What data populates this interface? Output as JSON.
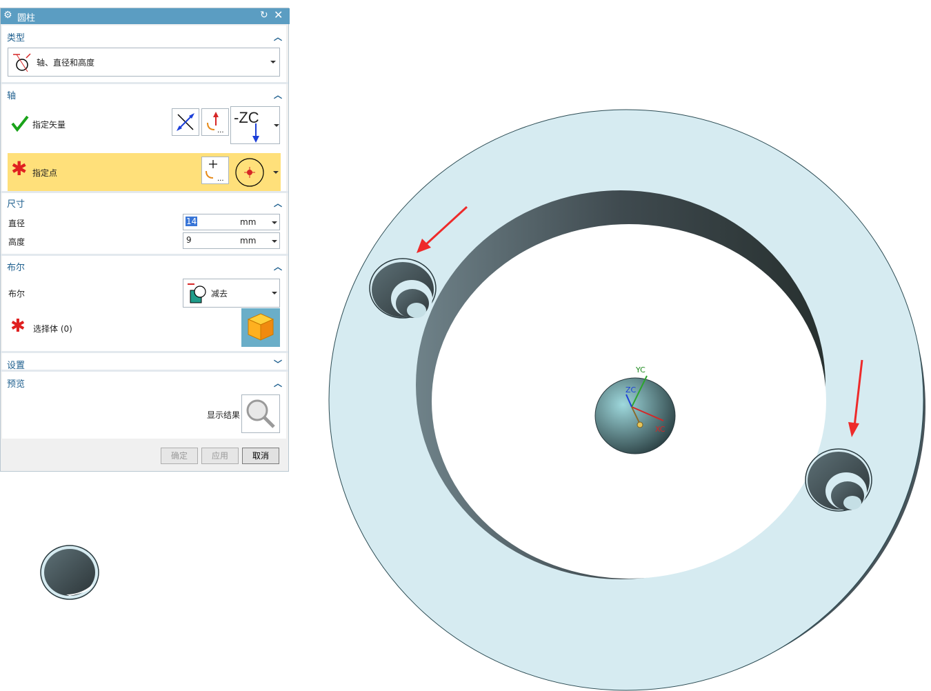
{
  "dialog": {
    "title": "圆柱",
    "sections": {
      "type": {
        "title": "类型",
        "selected": "轴、直径和高度"
      },
      "axis": {
        "title": "轴",
        "vector_label": "指定矢量",
        "point_label": "指定点",
        "vector_value": "-ZC"
      },
      "dimension": {
        "title": "尺寸",
        "diameter_label": "直径",
        "diameter_value": "14",
        "diameter_unit": "mm",
        "height_label": "高度",
        "height_value": "9",
        "height_unit": "mm"
      },
      "boolean": {
        "title": "布尔",
        "boolean_label": "布尔",
        "boolean_value": "减去",
        "select_body_label": "选择体 (0)"
      },
      "settings": {
        "title": "设置"
      },
      "preview": {
        "title": "预览",
        "show_result_label": "显示结果"
      }
    },
    "buttons": {
      "ok": "确定",
      "apply": "应用",
      "cancel": "取消"
    }
  },
  "viewport": {
    "axis_labels": {
      "y": "YC",
      "z": "ZC",
      "x": "XC"
    }
  },
  "colors": {
    "title_bar": "#5b9dc2",
    "highlight_row": "#ffe07a",
    "model_face": "#d6ebf1",
    "model_wall": "#3f4a4f"
  }
}
